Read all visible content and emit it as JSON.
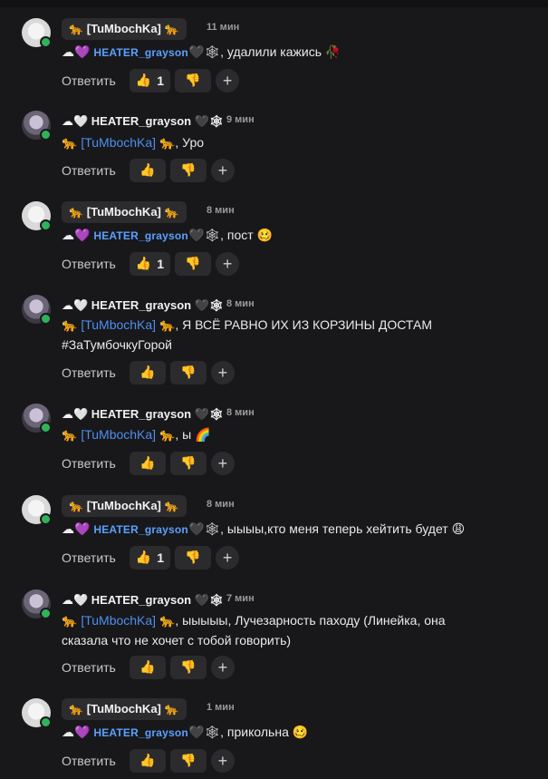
{
  "reply_label": "Ответить",
  "comments": [
    {
      "author": "🐆 [TuMbochKa] 🐆",
      "author_type": "tum",
      "time": "11 мин",
      "prefix": "☁💜",
      "mention": "HEATER_grayson",
      "mention_suffix": "🖤🕸",
      "text_after": ", удалили кажись 🥀",
      "text_line2": "",
      "like_count": "1"
    },
    {
      "author": "☁🤍 HEATER_grayson 🖤🕸",
      "author_type": "heater",
      "time": "9 мин",
      "prefix": "🐆",
      "mention": "[TuMbochKa]",
      "mention_suffix": "🐆",
      "text_after": ", Уро",
      "text_line2": "",
      "like_count": ""
    },
    {
      "author": "🐆 [TuMbochKa] 🐆",
      "author_type": "tum",
      "time": "8 мин",
      "prefix": "☁💜",
      "mention": "HEATER_grayson",
      "mention_suffix": "🖤🕸",
      "text_after": ", пост 🥴",
      "text_line2": "",
      "like_count": "1"
    },
    {
      "author": "☁🤍 HEATER_grayson 🖤🕸",
      "author_type": "heater",
      "time": "8 мин",
      "prefix": "🐆",
      "mention": "[TuMbochKa]",
      "mention_suffix": "🐆",
      "text_after": ", Я ВСЁ РАВНО ИХ ИЗ КОРЗИНЫ ДОСТАМ",
      "text_line2": "#ЗаТумбочкуГорой",
      "like_count": ""
    },
    {
      "author": "☁🤍 HEATER_grayson 🖤🕸",
      "author_type": "heater",
      "time": "8 мин",
      "prefix": "🐆",
      "mention": "[TuMbochKa]",
      "mention_suffix": "🐆",
      "text_after": ", ы 🌈",
      "text_line2": "",
      "like_count": ""
    },
    {
      "author": "🐆 [TuMbochKa] 🐆",
      "author_type": "tum",
      "time": "8 мин",
      "prefix": "☁💜",
      "mention": "HEATER_grayson",
      "mention_suffix": "🖤🕸",
      "text_after": ", ыыыы,кто меня теперь хейтить будет 😩",
      "text_line2": "",
      "like_count": "1"
    },
    {
      "author": "☁🤍 HEATER_grayson 🖤🕸",
      "author_type": "heater",
      "time": "7 мин",
      "prefix": "🐆",
      "mention": "[TuMbochKa]",
      "mention_suffix": "🐆",
      "text_after": ", ыыыыы, Лучезарность паходу (Линейка, она",
      "text_line2": "сказала что не хочет с тобой говорить)",
      "like_count": ""
    },
    {
      "author": "🐆 [TuMbochKa] 🐆",
      "author_type": "tum",
      "time": "1 мин",
      "prefix": "☁💜",
      "mention": "HEATER_grayson",
      "mention_suffix": "🖤🕸",
      "text_after": ", прикольна 🥴",
      "text_line2": "",
      "like_count": ""
    }
  ],
  "reactions": {
    "like_icon": "👍",
    "dislike_icon": "👎",
    "add_icon": "+"
  },
  "colors": {
    "mention": "#4d8ff0",
    "online": "#2fb35a",
    "background": "#18181a"
  }
}
